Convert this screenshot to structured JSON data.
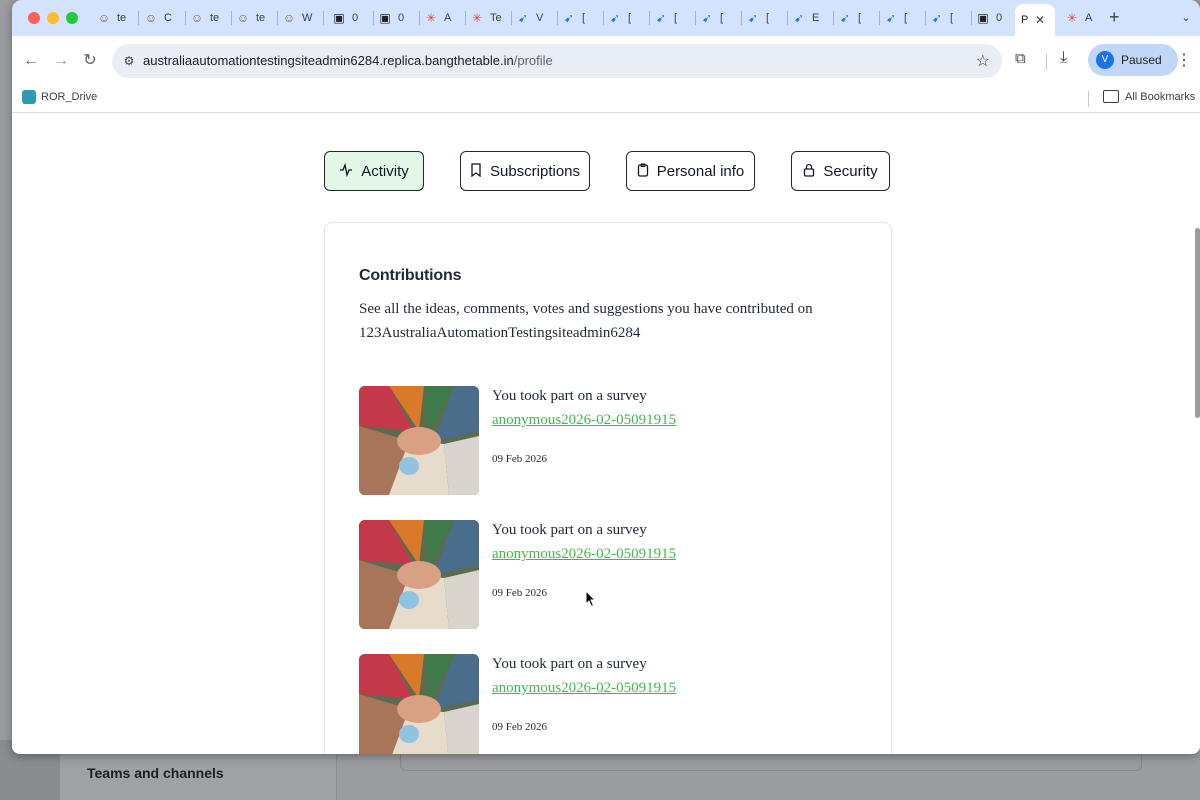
{
  "background_app": {
    "teams_label": "Teams and channels"
  },
  "browser": {
    "tabs": [
      {
        "icon": "avatar-icon",
        "title": "te"
      },
      {
        "icon": "avatar-icon",
        "title": "C"
      },
      {
        "icon": "avatar-icon",
        "title": "te"
      },
      {
        "icon": "avatar-icon",
        "title": "te"
      },
      {
        "icon": "avatar-icon",
        "title": "W"
      },
      {
        "icon": "robot-icon",
        "title": "0"
      },
      {
        "icon": "robot-icon",
        "title": "0"
      },
      {
        "icon": "asterisk-icon",
        "title": "A"
      },
      {
        "icon": "asterisk-icon",
        "title": "Te"
      },
      {
        "icon": "jira-icon",
        "title": "V"
      },
      {
        "icon": "jira-icon",
        "title": "["
      },
      {
        "icon": "jira-icon",
        "title": "["
      },
      {
        "icon": "jira-icon",
        "title": "["
      },
      {
        "icon": "jira-icon",
        "title": "["
      },
      {
        "icon": "jira-icon",
        "title": "["
      },
      {
        "icon": "jira-icon",
        "title": "E"
      },
      {
        "icon": "jira-icon",
        "title": "["
      },
      {
        "icon": "jira-icon",
        "title": "["
      },
      {
        "icon": "jira-icon",
        "title": "["
      },
      {
        "icon": "robot-icon",
        "title": "0"
      }
    ],
    "active_tab": {
      "title": "P"
    },
    "after_tab": {
      "icon": "asterisk-icon",
      "title": "A"
    },
    "url_host": "australiaautomationtestingsiteadmin6284.replica.bangthetable.in",
    "url_path": "/profile",
    "profile_initial": "V",
    "profile_label": "Paused",
    "bookmarks": [
      {
        "label": "ROR_Drive"
      }
    ],
    "all_bookmarks_label": "All Bookmarks"
  },
  "page": {
    "tabs": [
      {
        "label": "Activity",
        "icon": "activity-icon"
      },
      {
        "label": "Subscriptions",
        "icon": "bookmark-icon"
      },
      {
        "label": "Personal info",
        "icon": "clipboard-icon"
      },
      {
        "label": "Security",
        "icon": "lock-icon"
      }
    ],
    "contributions": {
      "title": "Contributions",
      "description": "See all the ideas, comments, votes and suggestions you have contributed on 123AustraliaAutomationTestingsiteadmin6284",
      "items": [
        {
          "text": "You took part on a survey",
          "link": "anonymous2026-02-05091915",
          "date": "09 Feb 2026"
        },
        {
          "text": "You took part on a survey",
          "link": "anonymous2026-02-05091915",
          "date": "09 Feb 2026"
        },
        {
          "text": "You took part on a survey",
          "link": "anonymous2026-02-05091915",
          "date": "09 Feb 2026"
        }
      ]
    }
  },
  "colors": {
    "active_tab_bg": "#e3f7e6",
    "link_green": "#3dba4e",
    "chrome_tabstrip": "#d3e3fd"
  }
}
